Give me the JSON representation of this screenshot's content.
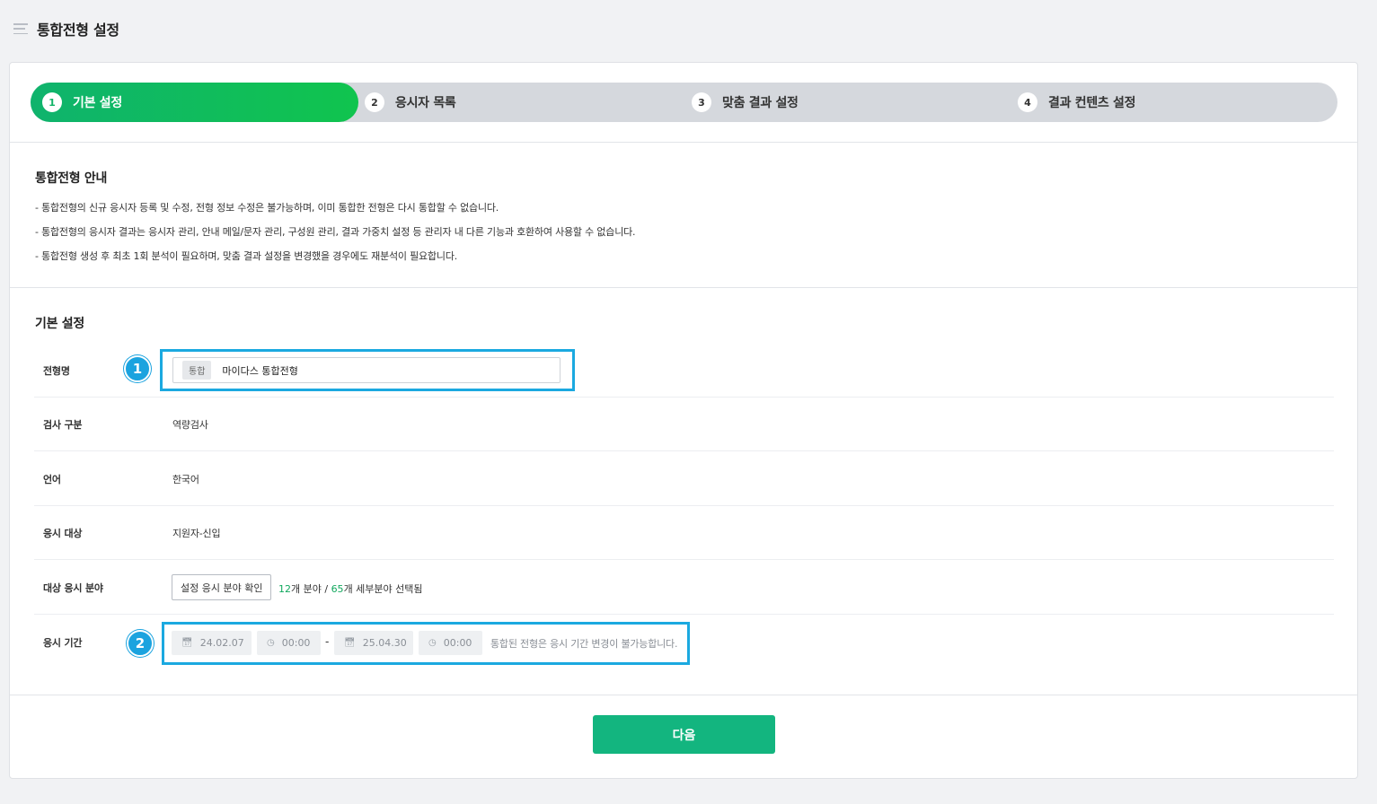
{
  "header": {
    "title": "통합전형 설정"
  },
  "steps": [
    {
      "num": "1",
      "label": "기본 설정"
    },
    {
      "num": "2",
      "label": "응시자 목록"
    },
    {
      "num": "3",
      "label": "맞춤 결과 설정"
    },
    {
      "num": "4",
      "label": "결과 컨텐츠 설정"
    }
  ],
  "notice": {
    "title": "통합전형 안내",
    "items": [
      "- 통합전형의 신규 응시자 등록 및 수정, 전형 정보 수정은 불가능하며, 이미 통합한 전형은 다시 통합할 수 없습니다.",
      "- 통합전형의 응시자 결과는 응시자 관리, 안내 메일/문자 관리, 구성원 관리, 결과 가중치 설정 등 관리자 내 다른 기능과 호환하여 사용할 수 없습니다.",
      "- 통합전형 생성 후 최초 1회 분석이 필요하며, 맞춤 결과 설정을 변경했을 경우에도 재분석이 필요합니다."
    ]
  },
  "basic": {
    "title": "기본 설정",
    "name_label": "전형명",
    "name_tag": "통합",
    "name_value": "마이다스 통합전형",
    "test_type_label": "검사 구분",
    "test_type_value": "역량검사",
    "language_label": "언어",
    "language_value": "한국어",
    "target_label": "응시 대상",
    "target_value": "지원자-신입",
    "field_label": "대상 응시 분야",
    "field_button": "설정 응시 분야 확인",
    "field_count_a": "12",
    "field_count_a_suffix": "개 분야 / ",
    "field_count_b": "65",
    "field_count_b_suffix": "개 세부분야 선택됨",
    "period_label": "응시 기간",
    "start_date": "24.02.07",
    "start_time": "00:00",
    "separator": "-",
    "end_date": "25.04.30",
    "end_time": "00:00",
    "period_note": "통합된 전형은 응시 기간 변경이 불가능합니다."
  },
  "markers": [
    "1",
    "2"
  ],
  "footer": {
    "next_label": "다음"
  },
  "colors": {
    "accent": "#12b468",
    "highlight": "#1ba9e0",
    "button": "#13b57f"
  }
}
